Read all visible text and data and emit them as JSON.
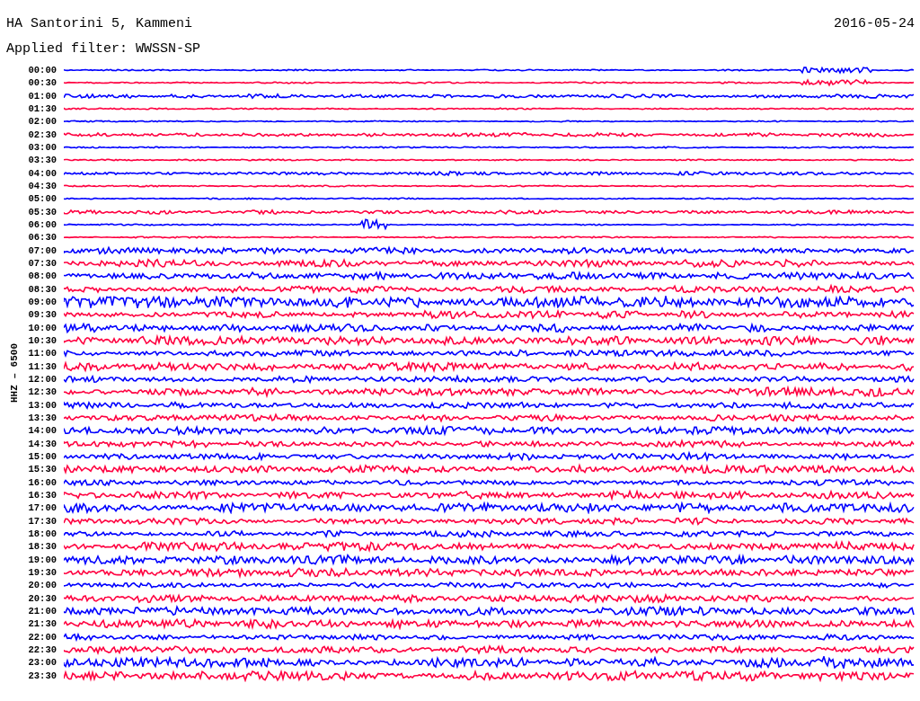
{
  "title": "HA Santorini 5, Kammeni",
  "date": "2016-05-24",
  "filter": "Applied filter: WWSSN-SP",
  "channel_label": "HHZ – 6500",
  "rows": [
    {
      "time": "00:00",
      "color": "#0000ff"
    },
    {
      "time": "00:30",
      "color": "#ff0040"
    },
    {
      "time": "01:00",
      "color": "#0000ff"
    },
    {
      "time": "01:30",
      "color": "#ff0040"
    },
    {
      "time": "02:00",
      "color": "#0000ff"
    },
    {
      "time": "02:30",
      "color": "#ff0040"
    },
    {
      "time": "03:00",
      "color": "#0000ff"
    },
    {
      "time": "03:30",
      "color": "#ff0040"
    },
    {
      "time": "04:00",
      "color": "#0000ff"
    },
    {
      "time": "04:30",
      "color": "#ff0040"
    },
    {
      "time": "05:00",
      "color": "#0000ff"
    },
    {
      "time": "05:30",
      "color": "#ff0040"
    },
    {
      "time": "06:00",
      "color": "#0000ff"
    },
    {
      "time": "06:30",
      "color": "#ff0040"
    },
    {
      "time": "07:00",
      "color": "#0000ff"
    },
    {
      "time": "07:30",
      "color": "#ff0040"
    },
    {
      "time": "08:00",
      "color": "#0000ff"
    },
    {
      "time": "08:30",
      "color": "#ff0040"
    },
    {
      "time": "09:00",
      "color": "#0000ff"
    },
    {
      "time": "09:30",
      "color": "#ff0040"
    },
    {
      "time": "10:00",
      "color": "#0000ff"
    },
    {
      "time": "10:30",
      "color": "#ff0040"
    },
    {
      "time": "11:00",
      "color": "#0000ff"
    },
    {
      "time": "11:30",
      "color": "#ff0040"
    },
    {
      "time": "12:00",
      "color": "#0000ff"
    },
    {
      "time": "12:30",
      "color": "#ff0040"
    },
    {
      "time": "13:00",
      "color": "#0000ff"
    },
    {
      "time": "13:30",
      "color": "#ff0040"
    },
    {
      "time": "14:00",
      "color": "#0000ff"
    },
    {
      "time": "14:30",
      "color": "#ff0040"
    },
    {
      "time": "15:00",
      "color": "#0000ff"
    },
    {
      "time": "15:30",
      "color": "#ff0040"
    },
    {
      "time": "16:00",
      "color": "#0000ff"
    },
    {
      "time": "16:30",
      "color": "#ff0040"
    },
    {
      "time": "17:00",
      "color": "#0000ff"
    },
    {
      "time": "17:30",
      "color": "#ff0040"
    },
    {
      "time": "18:00",
      "color": "#0000ff"
    },
    {
      "time": "18:30",
      "color": "#ff0040"
    },
    {
      "time": "19:00",
      "color": "#0000ff"
    },
    {
      "time": "19:30",
      "color": "#ff0040"
    },
    {
      "time": "20:00",
      "color": "#0000ff"
    },
    {
      "time": "20:30",
      "color": "#ff0040"
    },
    {
      "time": "21:00",
      "color": "#0000ff"
    },
    {
      "time": "21:30",
      "color": "#ff0040"
    },
    {
      "time": "22:00",
      "color": "#0000ff"
    },
    {
      "time": "22:30",
      "color": "#ff0040"
    },
    {
      "time": "23:00",
      "color": "#0000ff"
    },
    {
      "time": "23:30",
      "color": "#ff0040"
    }
  ]
}
